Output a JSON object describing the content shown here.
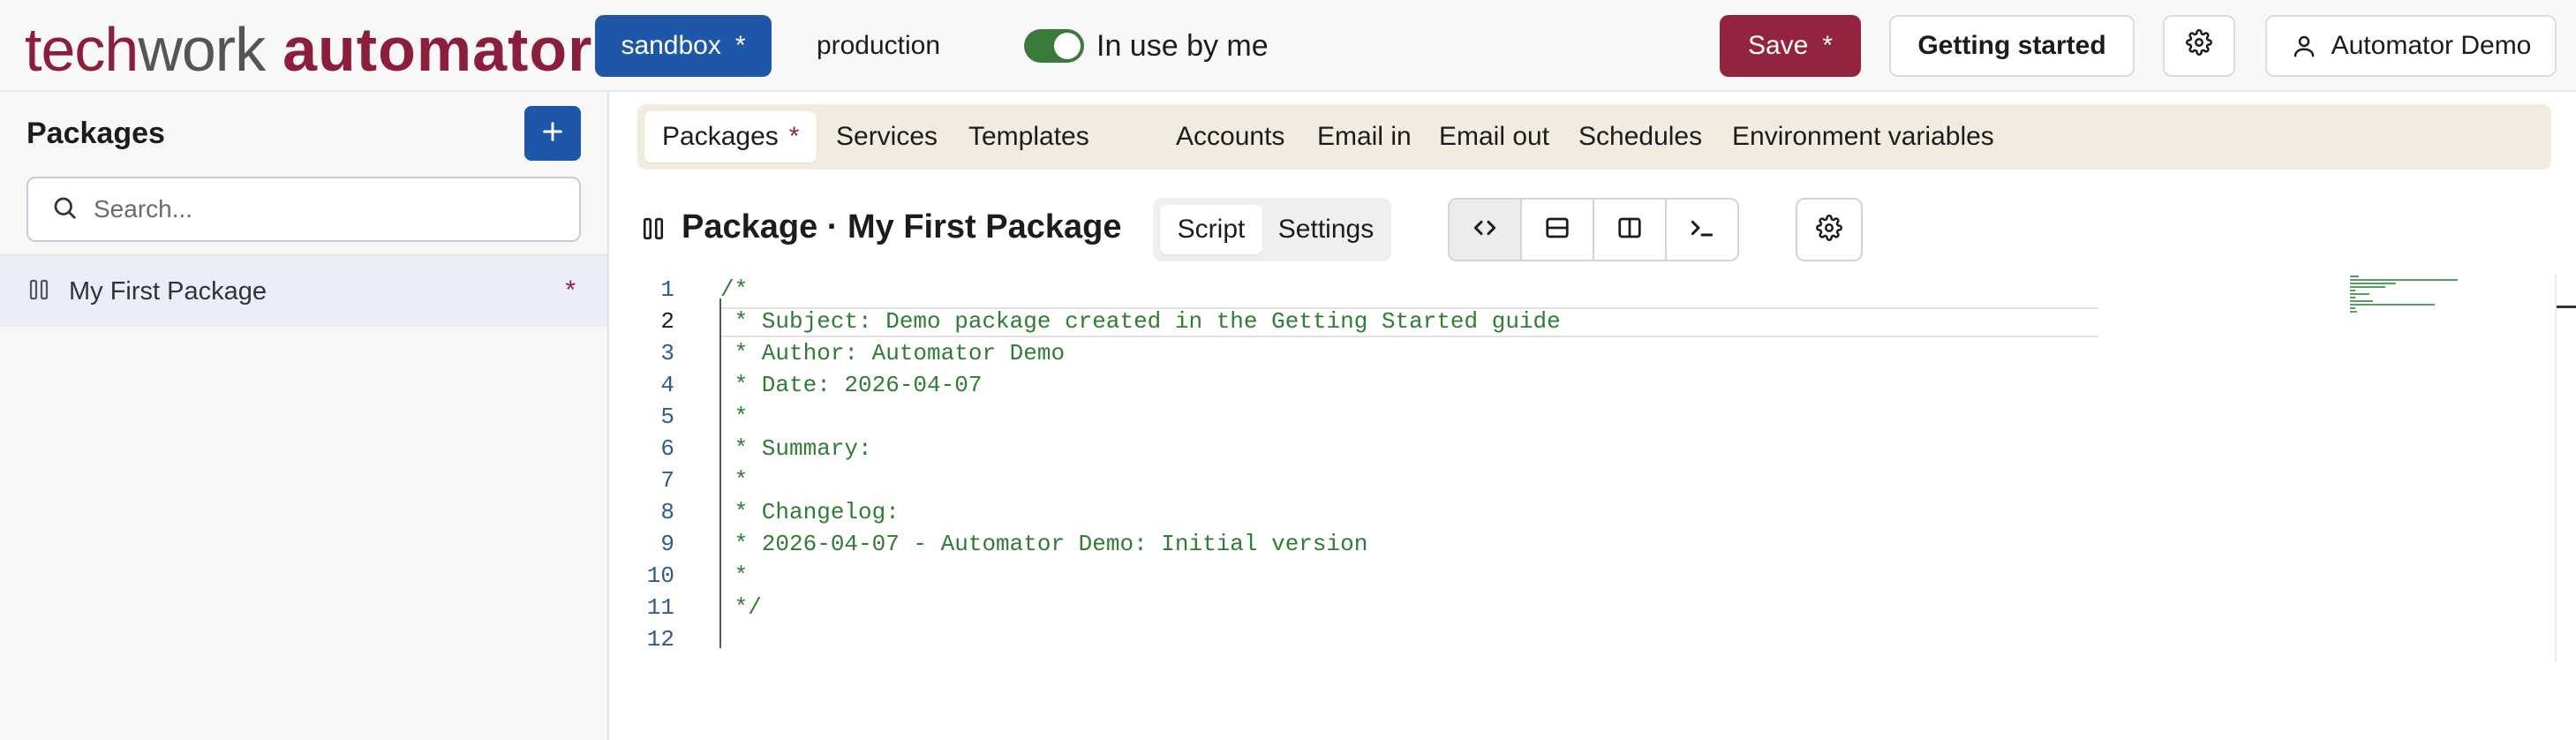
{
  "header": {
    "logo": {
      "part1": "tech",
      "part2": "work",
      "part3": "automator",
      "dot": ".",
      "dot_color": "#c9a96a",
      "brand_color": "#8c1e3c"
    },
    "environments": [
      {
        "label": "sandbox",
        "modified": "*",
        "active": true
      },
      {
        "label": "production",
        "active": false
      }
    ],
    "in_use_toggle": {
      "label": "In use by me",
      "on": true,
      "color": "#3a7b3c"
    },
    "save_button": {
      "label": "Save",
      "modified": "*",
      "color": "#93233f"
    },
    "getting_started": "Getting started",
    "settings_icon": "gear-icon",
    "user": {
      "icon": "user-icon",
      "name": "Automator Demo"
    }
  },
  "sidebar": {
    "title": "Packages",
    "add_icon": "plus-icon",
    "search": {
      "placeholder": "Search...",
      "value": ""
    },
    "items": [
      {
        "label": "My First Package",
        "modified": "*",
        "icon": "package-icon",
        "selected": true
      }
    ]
  },
  "main": {
    "tabs": [
      {
        "label": "Packages",
        "modified": "*",
        "active": true
      },
      {
        "label": "Services"
      },
      {
        "label": "Templates"
      },
      {
        "label": "Accounts"
      },
      {
        "label": "Email in"
      },
      {
        "label": "Email out"
      },
      {
        "label": "Schedules"
      },
      {
        "label": "Environment variables"
      }
    ],
    "package_title": "Package · My First Package",
    "view_tabs": [
      {
        "label": "Script",
        "active": true
      },
      {
        "label": "Settings",
        "active": false
      }
    ],
    "layout_buttons": [
      "code-icon",
      "split-horizontal-icon",
      "split-vertical-icon",
      "terminal-icon"
    ],
    "settings_icon": "gear-icon"
  },
  "editor": {
    "current_line": 2,
    "lines": [
      {
        "num": "1",
        "text": "/*"
      },
      {
        "num": "2",
        "text": " * Subject: Demo package created in the Getting Started guide"
      },
      {
        "num": "3",
        "text": " * Author: Automator Demo"
      },
      {
        "num": "4",
        "text": " * Date: 2026-04-07"
      },
      {
        "num": "5",
        "text": " *"
      },
      {
        "num": "6",
        "text": " * Summary:"
      },
      {
        "num": "7",
        "text": " *"
      },
      {
        "num": "8",
        "text": " * Changelog:"
      },
      {
        "num": "9",
        "text": " * 2026-04-07 - Automator Demo: Initial version"
      },
      {
        "num": "10",
        "text": " *"
      },
      {
        "num": "11",
        "text": " */"
      },
      {
        "num": "12",
        "text": ""
      }
    ]
  }
}
